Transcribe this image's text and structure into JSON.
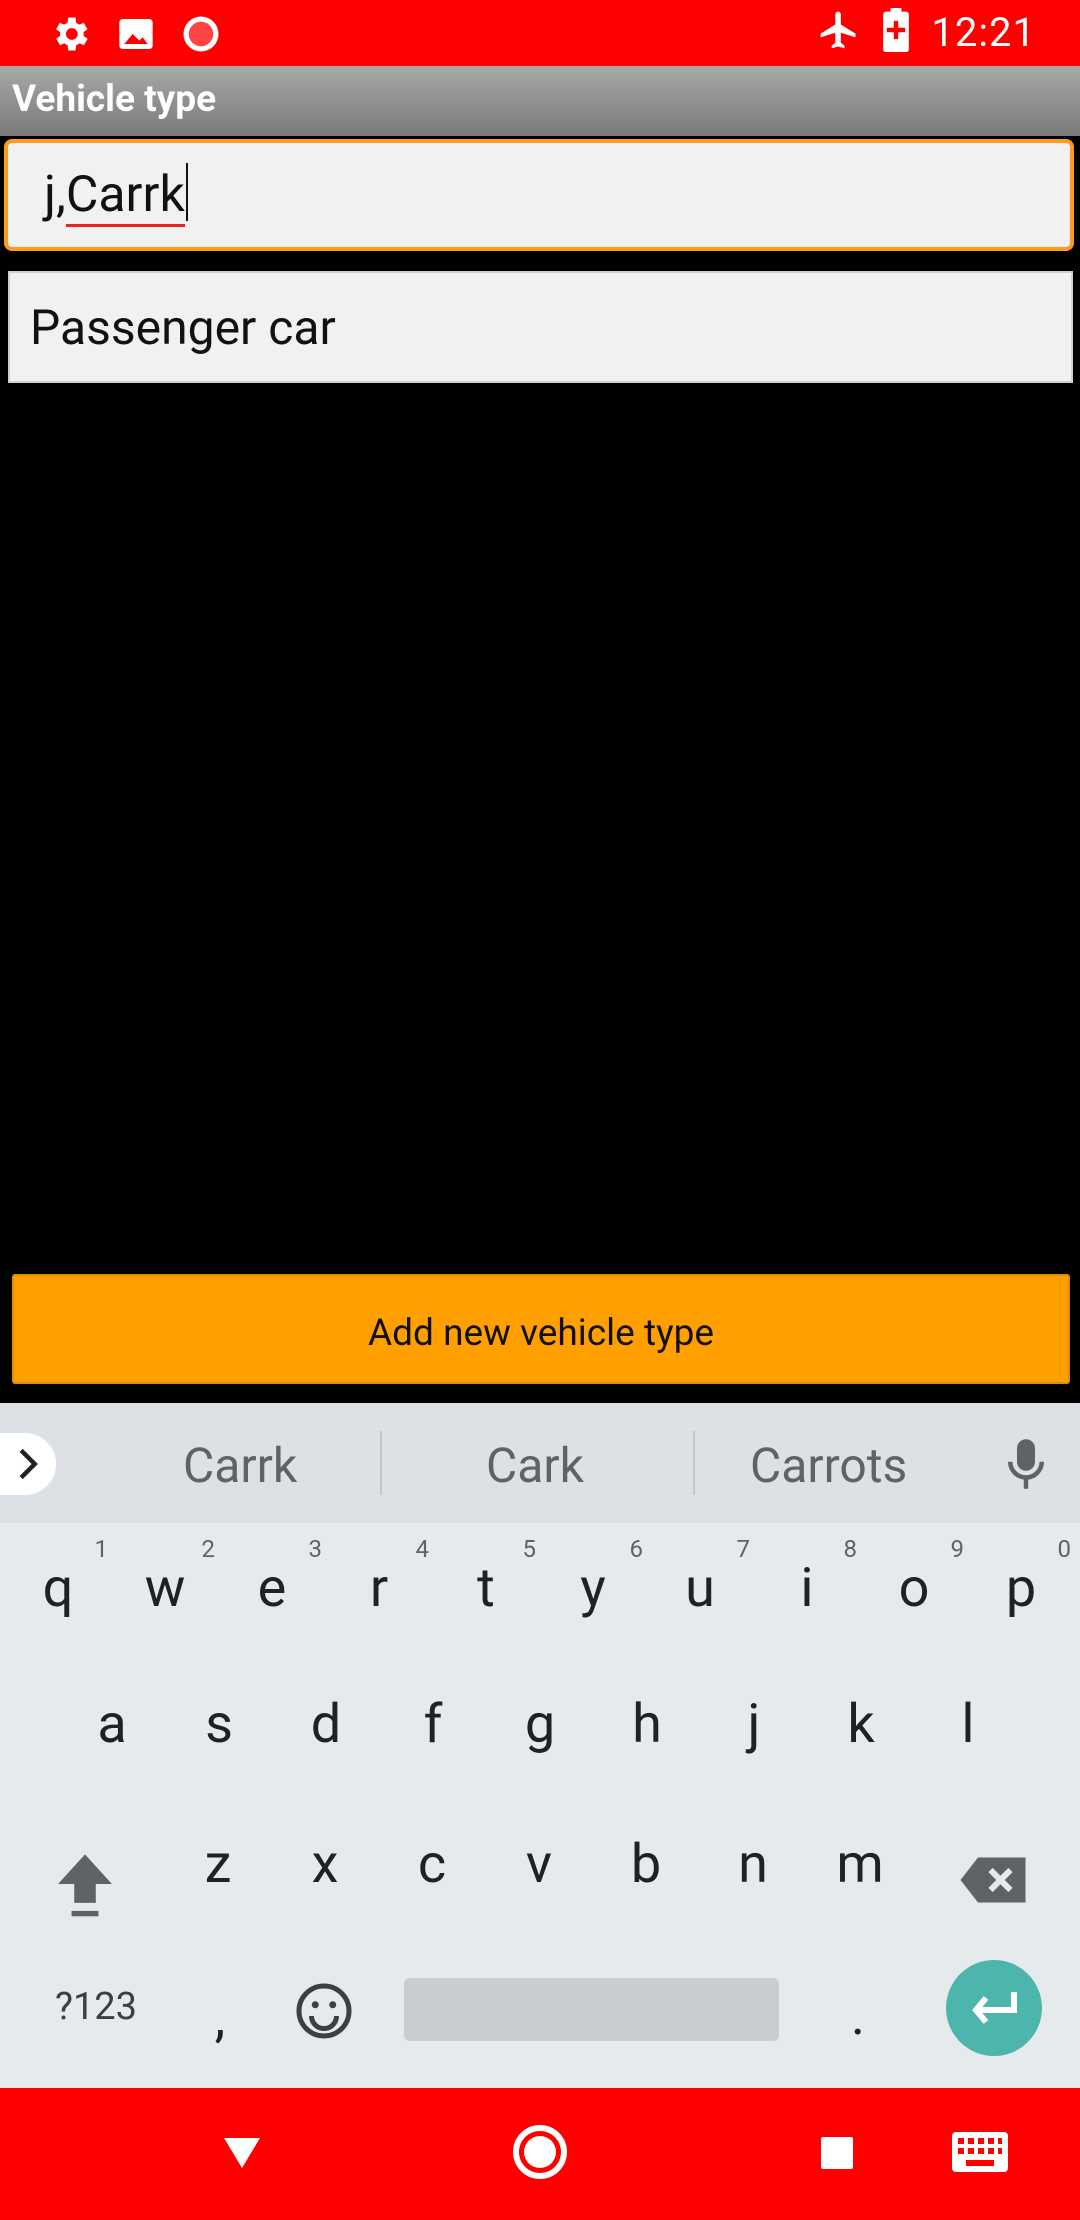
{
  "status_bar": {
    "time": "12:21",
    "left_icons": [
      "settings-icon",
      "image-icon",
      "record-icon"
    ],
    "right_icons": [
      "airplane-mode-icon",
      "battery-charging-icon"
    ],
    "background": "#ff0000"
  },
  "toolbar": {
    "title": "Vehicle type",
    "background": "#888888"
  },
  "edit_field": {
    "prefix": "j,",
    "word": "Carrk",
    "accent": "#ff9a1a"
  },
  "list": {
    "items": [
      {
        "label": "Passenger car"
      }
    ]
  },
  "add_button": {
    "label": "Add new vehicle type",
    "color": "#ffa000"
  },
  "keyboard": {
    "suggestions": [
      "Carrk",
      "Cark",
      "Carrots"
    ],
    "row1": [
      {
        "k": "q",
        "n": "1"
      },
      {
        "k": "w",
        "n": "2"
      },
      {
        "k": "e",
        "n": "3"
      },
      {
        "k": "r",
        "n": "4"
      },
      {
        "k": "t",
        "n": "5"
      },
      {
        "k": "y",
        "n": "6"
      },
      {
        "k": "u",
        "n": "7"
      },
      {
        "k": "i",
        "n": "8"
      },
      {
        "k": "o",
        "n": "9"
      },
      {
        "k": "p",
        "n": "0"
      }
    ],
    "row2": [
      "a",
      "s",
      "d",
      "f",
      "g",
      "h",
      "j",
      "k",
      "l"
    ],
    "row3": [
      "z",
      "x",
      "c",
      "v",
      "b",
      "n",
      "m"
    ],
    "symbols_label": "?123",
    "comma": ",",
    "period": ".",
    "enter_color": "#4db6ac"
  },
  "nav_bar": {
    "buttons": [
      "back-icon",
      "home-icon",
      "recents-icon",
      "keyboard-icon"
    ],
    "background": "#ff0000"
  }
}
